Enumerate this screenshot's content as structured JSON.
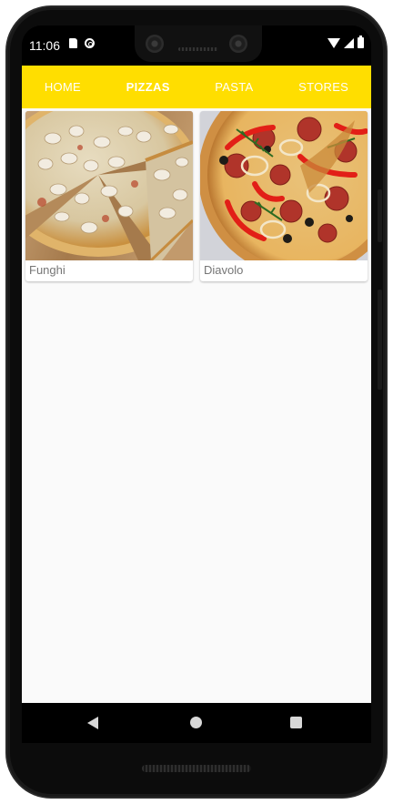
{
  "status_bar": {
    "time": "11:06",
    "left_icons": [
      "sd-card-icon",
      "at-sign-icon"
    ],
    "right_icons": [
      "wifi-icon",
      "signal-icon",
      "battery-icon"
    ]
  },
  "app_bar": {
    "background_color": "#ffde00",
    "tabs": [
      {
        "label": "HOME",
        "active": false
      },
      {
        "label": "PIZZAS",
        "active": true
      },
      {
        "label": "PASTA",
        "active": false
      },
      {
        "label": "STORES",
        "active": false
      }
    ]
  },
  "products": [
    {
      "name": "Funghi",
      "image": "mushroom-pizza-photo"
    },
    {
      "name": "Diavolo",
      "image": "salami-pepper-pizza-photo"
    }
  ],
  "nav_bar": {
    "buttons": [
      "back-icon",
      "home-icon",
      "recent-apps-icon"
    ]
  }
}
